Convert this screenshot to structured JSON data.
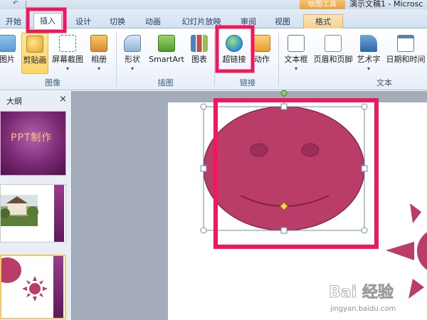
{
  "titlebar": {
    "context_header": "绘图工具",
    "document_title": "演示文稿1 - Microsc"
  },
  "tabs": [
    {
      "label": "开始"
    },
    {
      "label": "插入"
    },
    {
      "label": "设计"
    },
    {
      "label": "切换"
    },
    {
      "label": "动画"
    },
    {
      "label": "幻灯片放映"
    },
    {
      "label": "审阅"
    },
    {
      "label": "视图"
    },
    {
      "label": "格式"
    }
  ],
  "ribbon": {
    "buttons": {
      "picture": "图片",
      "clipart": "剪贴画",
      "screenshot": "屏幕截图",
      "album": "相册",
      "shapes": "形状",
      "smartart": "SmartArt",
      "chart": "图表",
      "hyperlink": "超链接",
      "action": "动作",
      "textbox": "文本框",
      "header_footer": "页眉和页脚",
      "wordart": "艺术字",
      "datetime": "日期和时间"
    },
    "groups": {
      "images": "图像",
      "illustrations": "插图",
      "links": "链接",
      "text": "文本"
    }
  },
  "panel": {
    "tab": "大纲",
    "close": "×"
  },
  "slides": {
    "slide1_title": "PPT制作"
  },
  "watermark": {
    "brand": "Bai 经验",
    "url": "jingyan.baidu.com"
  },
  "colors": {
    "shape_fill": "#b93d68",
    "shape_stroke": "#8a2b4d",
    "highlight": "#f0185c",
    "accent": "#f0b24a"
  }
}
